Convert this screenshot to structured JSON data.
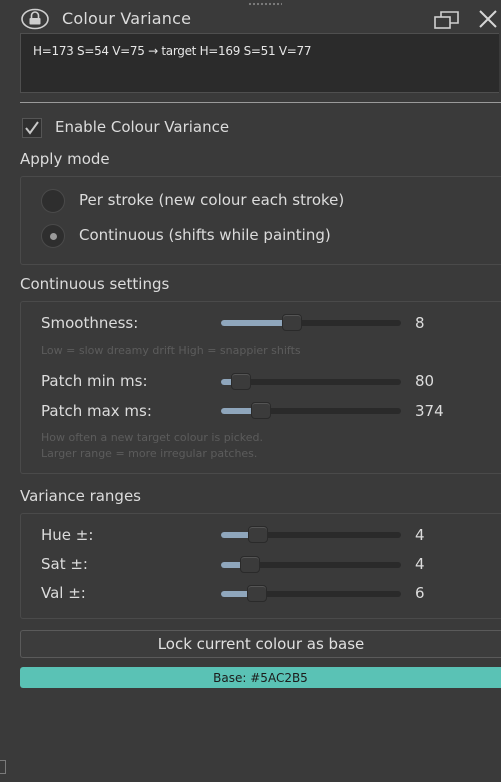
{
  "panel": {
    "title": "Colour Variance",
    "status": "H=173 S=54 V=75 → target H=169 S=51 V=77"
  },
  "enable": {
    "label": "Enable Colour Variance",
    "checked": true
  },
  "apply_mode": {
    "heading": "Apply mode",
    "options": [
      {
        "label": "Per stroke  (new colour each stroke)",
        "selected": false
      },
      {
        "label": "Continuous  (shifts while painting)",
        "selected": true
      }
    ]
  },
  "continuous": {
    "heading": "Continuous settings",
    "smoothness": {
      "label": "Smoothness:",
      "value": "8",
      "fraction": 0.38
    },
    "smooth_hint": "Low = slow dreamy drift   High = snappier shifts",
    "patch_min": {
      "label": "Patch min ms:",
      "value": "80",
      "fraction": 0.06
    },
    "patch_max": {
      "label": "Patch max ms:",
      "value": "374",
      "fraction": 0.19
    },
    "patch_hint_1": "How often a new target colour is picked.",
    "patch_hint_2": "Larger range = more irregular patches."
  },
  "ranges": {
    "heading": "Variance ranges",
    "hue": {
      "label": "Hue ±:",
      "value": "4",
      "fraction": 0.17
    },
    "sat": {
      "label": "Sat ±:",
      "value": "4",
      "fraction": 0.12
    },
    "val": {
      "label": "Val ±:",
      "value": "6",
      "fraction": 0.16
    }
  },
  "lock_button": "Lock current colour as base",
  "base": {
    "label": "Base: #5AC2B5",
    "color": "#5AC2B5"
  },
  "colors": {
    "accent": "#8fa6bc",
    "background": "#3a3a3a",
    "base_swatch": "#5AC2B5"
  },
  "icons": {
    "lock": "lock-icon",
    "float": "float-window-icon",
    "close": "close-icon",
    "check": "checkmark-icon"
  }
}
